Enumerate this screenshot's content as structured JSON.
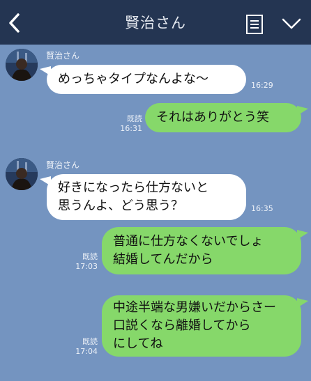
{
  "header": {
    "title": "賢治さん"
  },
  "messages": [
    {
      "sender": "賢治さん",
      "text": "めっちゃタイプなんよな〜",
      "time": "16:29"
    },
    {
      "text": "それはありがとう笑",
      "read": "既読",
      "time": "16:31"
    },
    {
      "sender": "賢治さん",
      "text": "好きになったら仕方ないと\n思うんよ、どう思う？",
      "time": "16:35"
    },
    {
      "text": "普通に仕方なくないでしょ\n結婚してんだから",
      "read": "既読",
      "time": "17:03"
    },
    {
      "text": "中途半端な男嫌いだからさー\n口説くなら離婚してから\nにしてね",
      "read": "既読",
      "time": "17:04"
    }
  ],
  "colors": {
    "background": "#7494c0",
    "header": "#243552",
    "incoming_bubble": "#ffffff",
    "outgoing_bubble": "#86d86a"
  },
  "icons": {
    "back": "chevron-left-icon",
    "menu": "menu-list-icon",
    "expand": "chevron-down-icon",
    "avatar": "avatar-photo"
  }
}
